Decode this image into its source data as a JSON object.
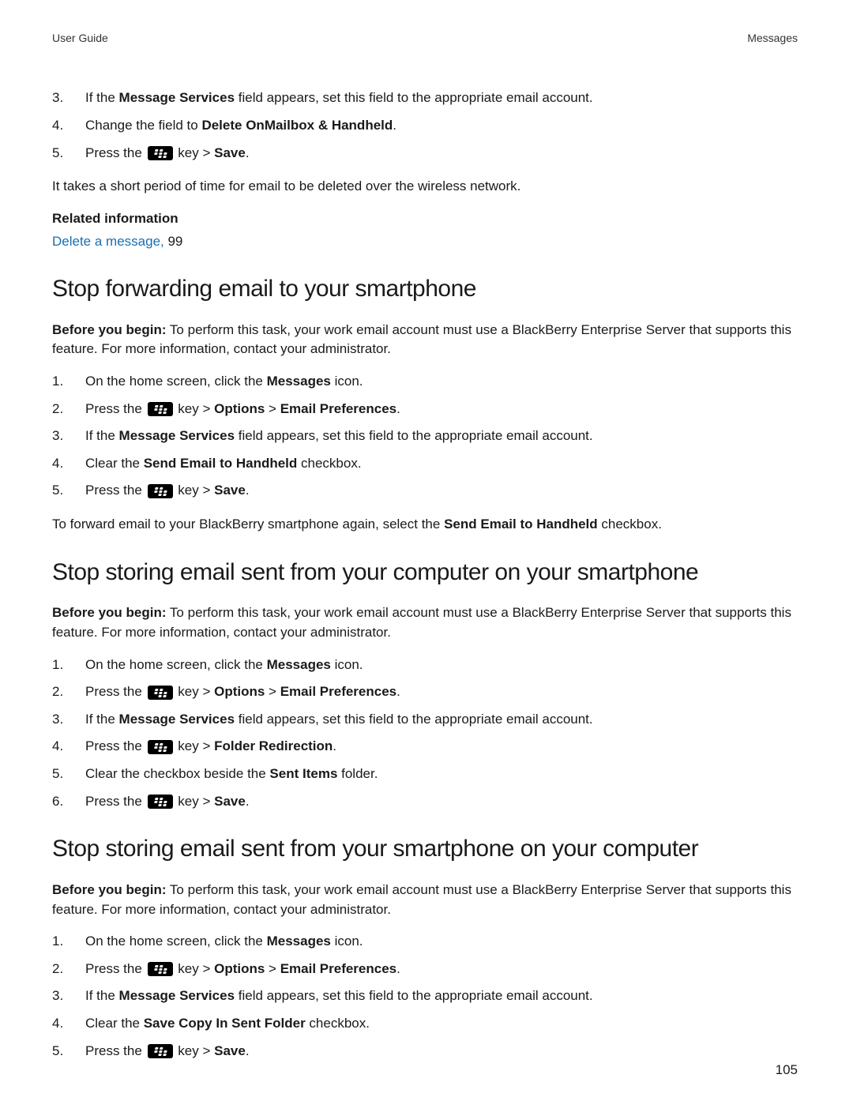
{
  "header": {
    "left": "User Guide",
    "right": "Messages"
  },
  "introSteps": {
    "start": 3,
    "items": [
      {
        "pre": "If the ",
        "bold1": "Message Services",
        "post": " field appears, set this field to the appropriate email account."
      },
      {
        "pre": "Change the ",
        "bold1": "Delete On",
        "mid": " field to ",
        "bold2": "Mailbox & Handheld",
        "post": "."
      },
      {
        "pre": "Press the ",
        "icon": true,
        "mid": " key > ",
        "bold1": "Save",
        "post": "."
      }
    ]
  },
  "afterIntro": {
    "line1": "It takes a short period of time for email to be deleted over the wireless network.",
    "relatedLabel": "Related information",
    "link": "Delete a message,",
    "linkPage": " 99"
  },
  "sections": [
    {
      "id": "stop-forwarding",
      "title": "Stop forwarding email to your smartphone",
      "before": {
        "label": "Before you begin:",
        "text": " To perform this task, your work email account must use a BlackBerry Enterprise Server that supports this feature. For more information, contact your administrator."
      },
      "steps": [
        {
          "pre": "On the home screen, click the ",
          "bold1": "Messages",
          "post": " icon."
        },
        {
          "pre": "Press the ",
          "icon": true,
          "mid": " key > ",
          "bold1": "Options",
          "mid2": " > ",
          "bold2": "Email Preferences",
          "post": "."
        },
        {
          "pre": "If the ",
          "bold1": "Message Services",
          "post": " field appears, set this field to the appropriate email account."
        },
        {
          "pre": "Clear the ",
          "bold1": "Send Email to Handheld",
          "post": " checkbox."
        },
        {
          "pre": "Press the ",
          "icon": true,
          "mid": " key > ",
          "bold1": "Save",
          "post": "."
        }
      ],
      "after": {
        "pre": "To forward email to your BlackBerry smartphone again, select the ",
        "bold1": "Send Email to Handheld",
        "post": " checkbox."
      }
    },
    {
      "id": "stop-storing-computer",
      "title": "Stop storing email sent from your computer on your smartphone",
      "before": {
        "label": "Before you begin:",
        "text": " To perform this task, your work email account must use a BlackBerry Enterprise Server that supports this feature. For more information, contact your administrator."
      },
      "steps": [
        {
          "pre": "On the home screen, click the ",
          "bold1": "Messages",
          "post": " icon."
        },
        {
          "pre": "Press the ",
          "icon": true,
          "mid": " key > ",
          "bold1": "Options",
          "mid2": " > ",
          "bold2": "Email Preferences",
          "post": "."
        },
        {
          "pre": "If the ",
          "bold1": "Message Services",
          "post": " field appears, set this field to the appropriate email account."
        },
        {
          "pre": "Press the ",
          "icon": true,
          "mid": " key > ",
          "bold1": "Folder Redirection",
          "post": "."
        },
        {
          "pre": "Clear the checkbox beside the ",
          "bold1": "Sent Items",
          "post": " folder."
        },
        {
          "pre": "Press the ",
          "icon": true,
          "mid": " key > ",
          "bold1": "Save",
          "post": "."
        }
      ]
    },
    {
      "id": "stop-storing-smartphone",
      "title": "Stop storing email sent from your smartphone on your computer",
      "before": {
        "label": "Before you begin:",
        "text": " To perform this task, your work email account must use a BlackBerry Enterprise Server that supports this feature. For more information, contact your administrator."
      },
      "steps": [
        {
          "pre": "On the home screen, click the ",
          "bold1": "Messages",
          "post": " icon."
        },
        {
          "pre": "Press the ",
          "icon": true,
          "mid": " key > ",
          "bold1": "Options",
          "mid2": " > ",
          "bold2": "Email Preferences",
          "post": "."
        },
        {
          "pre": "If the ",
          "bold1": "Message Services",
          "post": " field appears, set this field to the appropriate email account."
        },
        {
          "pre": "Clear the ",
          "bold1": "Save Copy In Sent Folder",
          "post": " checkbox."
        },
        {
          "pre": "Press the ",
          "icon": true,
          "mid": " key > ",
          "bold1": "Save",
          "post": "."
        }
      ]
    }
  ],
  "pageNumber": "105"
}
